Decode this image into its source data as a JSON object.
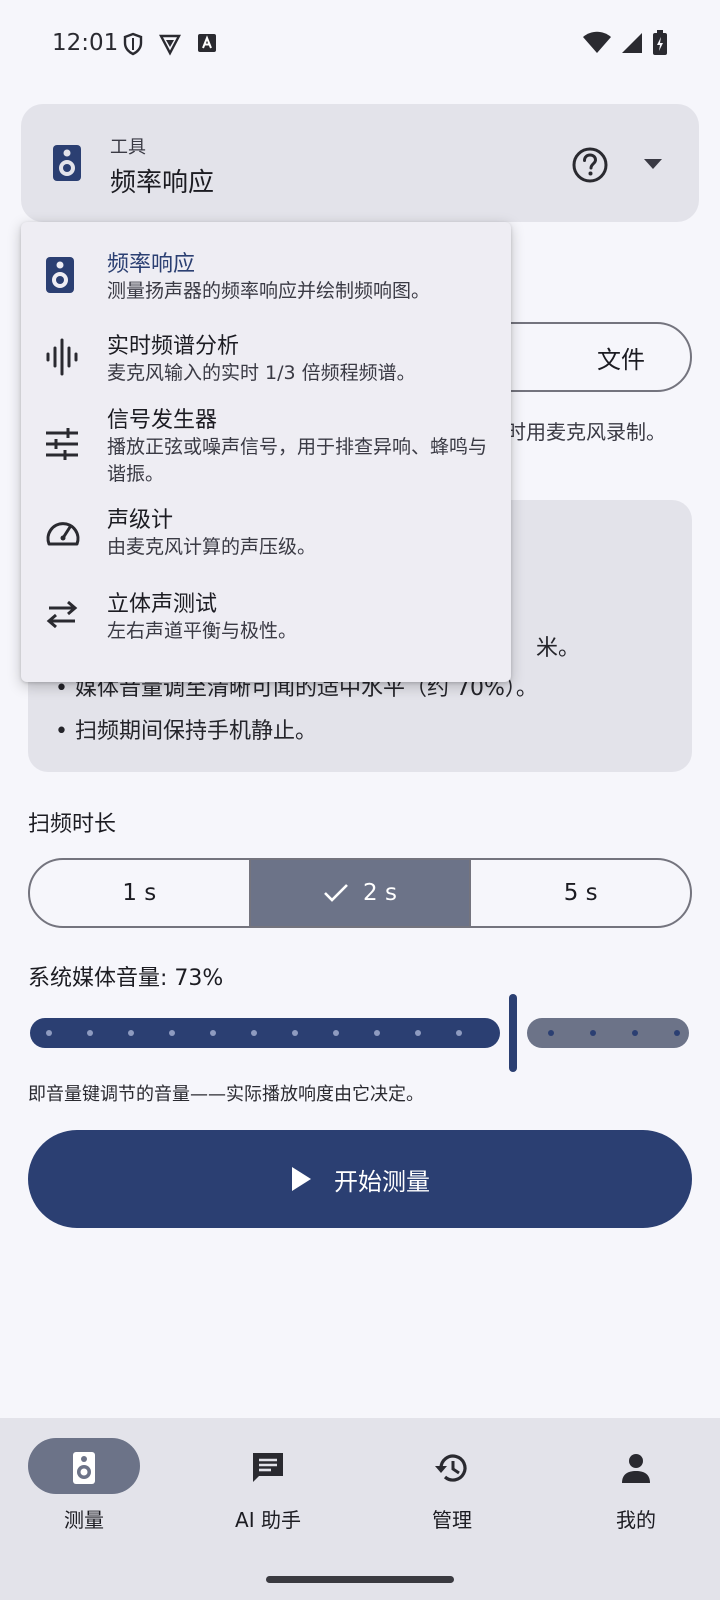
{
  "status_bar": {
    "time": "12:01"
  },
  "tool_selector": {
    "label": "工具",
    "value": "频率响应",
    "icon": "speaker-icon"
  },
  "source_toggle": {
    "file_label": "文件"
  },
  "hint": {
    "text": "时用麦克风录制。"
  },
  "tips": {
    "partial_line": "米。",
    "item_volume": "•  媒体音量调至清晰可闻的适中水平（约 70%）。",
    "item_steady": "•  扫频期间保持手机静止。"
  },
  "sweep": {
    "title": "扫频时长",
    "options": [
      "1 s",
      "2 s",
      "5 s"
    ],
    "selected": "2 s"
  },
  "volume": {
    "label": "系统媒体音量: 73%",
    "value_percent": 73,
    "help": "即音量键调节的音量——实际播放响度由它决定。"
  },
  "start_button": {
    "label": "开始测量"
  },
  "menu": {
    "items": [
      {
        "title": "频率响应",
        "desc": "测量扬声器的频率响应并绘制频响图。",
        "icon": "speaker-icon",
        "active": true
      },
      {
        "title": "实时频谱分析",
        "desc": "麦克风输入的实时 1/3 倍频程频谱。",
        "icon": "waveform-icon",
        "active": false
      },
      {
        "title": "信号发生器",
        "desc": "播放正弦或噪声信号，用于排查异响、蜂鸣与谐振。",
        "icon": "tune-icon",
        "active": false
      },
      {
        "title": "声级计",
        "desc": "由麦克风计算的声压级。",
        "icon": "speed-gauge-icon",
        "active": false
      },
      {
        "title": "立体声测试",
        "desc": "左右声道平衡与极性。",
        "icon": "swap-arrows-icon",
        "active": false
      }
    ]
  },
  "bottom_nav": {
    "items": [
      {
        "label": "测量",
        "icon": "speaker-icon",
        "selected": true
      },
      {
        "label": "AI 助手",
        "icon": "chat-icon",
        "selected": false
      },
      {
        "label": "管理",
        "icon": "history-icon",
        "selected": false
      },
      {
        "label": "我的",
        "icon": "person-icon",
        "selected": false
      }
    ]
  },
  "colors": {
    "primary": "#2b3f72",
    "secondary_container": "#6c7388",
    "surface_container": "#e3e3ea",
    "background": "#f6f6fb"
  }
}
